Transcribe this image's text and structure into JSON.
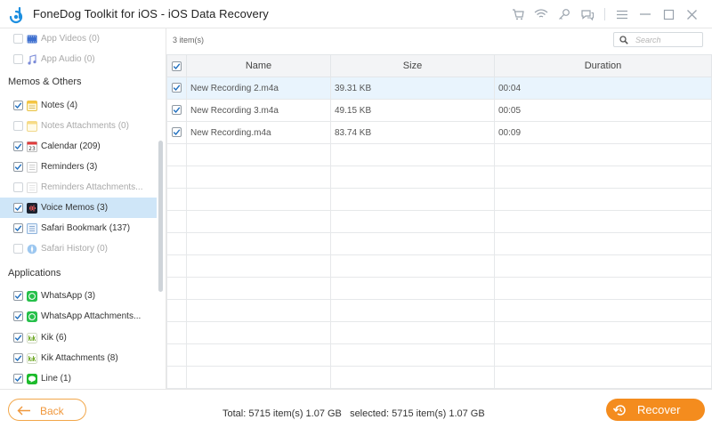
{
  "window": {
    "title": "FoneDog Toolkit for iOS - iOS Data Recovery",
    "controls": [
      "cart-icon",
      "wifi-icon",
      "key-icon",
      "chat-icon",
      "menu-icon",
      "minimize-icon",
      "maximize-icon",
      "close-icon"
    ]
  },
  "sidebar": {
    "top_items": [
      {
        "label": "App Videos (0)",
        "checked": false,
        "dim": true,
        "icon": "app-videos-icon"
      },
      {
        "label": "App Audio (0)",
        "checked": false,
        "dim": true,
        "icon": "app-audio-icon"
      }
    ],
    "section_memos": "Memos & Others",
    "memo_items": [
      {
        "label": "Notes (4)",
        "checked": true,
        "dim": false,
        "icon": "notes-icon"
      },
      {
        "label": "Notes Attachments (0)",
        "checked": false,
        "dim": true,
        "icon": "notes-attachments-icon"
      },
      {
        "label": "Calendar (209)",
        "checked": true,
        "dim": false,
        "icon": "calendar-icon"
      },
      {
        "label": "Reminders (3)",
        "checked": true,
        "dim": false,
        "icon": "reminders-icon"
      },
      {
        "label": "Reminders Attachments...",
        "checked": false,
        "dim": true,
        "icon": "reminders-attachments-icon"
      },
      {
        "label": "Voice Memos (3)",
        "checked": true,
        "dim": false,
        "icon": "voice-memos-icon",
        "selected": true
      },
      {
        "label": "Safari Bookmark (137)",
        "checked": true,
        "dim": false,
        "icon": "safari-bookmark-icon"
      },
      {
        "label": "Safari History (0)",
        "checked": false,
        "dim": true,
        "icon": "safari-history-icon"
      }
    ],
    "section_apps": "Applications",
    "app_items": [
      {
        "label": "WhatsApp (3)",
        "checked": true,
        "dim": false,
        "icon": "whatsapp-icon"
      },
      {
        "label": "WhatsApp Attachments...",
        "checked": true,
        "dim": false,
        "icon": "whatsapp-attachments-icon"
      },
      {
        "label": "Kik (6)",
        "checked": true,
        "dim": false,
        "icon": "kik-icon"
      },
      {
        "label": "Kik Attachments (8)",
        "checked": true,
        "dim": false,
        "icon": "kik-attachments-icon"
      },
      {
        "label": "Line (1)",
        "checked": true,
        "dim": false,
        "icon": "line-icon"
      }
    ]
  },
  "main": {
    "count_label": "3 item(s)",
    "search_placeholder": "Search",
    "columns": [
      "Name",
      "Size",
      "Duration"
    ],
    "rows": [
      {
        "name": "New Recording 2.m4a",
        "size": "39.31 KB",
        "duration": "00:04",
        "checked": true,
        "selected": true
      },
      {
        "name": "New Recording 3.m4a",
        "size": "49.15 KB",
        "duration": "00:05",
        "checked": true,
        "selected": false
      },
      {
        "name": "New Recording.m4a",
        "size": "83.74 KB",
        "duration": "00:09",
        "checked": true,
        "selected": false
      }
    ],
    "empty_rows": 11
  },
  "footer": {
    "back_label": "Back",
    "totals": "Total: 5715 item(s) 1.07 GB   selected: 5715 item(s) 1.07 GB",
    "recover_label": "Recover"
  },
  "colors": {
    "accent": "#f48c1e",
    "selection": "#cfe6f8",
    "row_selection": "#e9f4fd"
  }
}
